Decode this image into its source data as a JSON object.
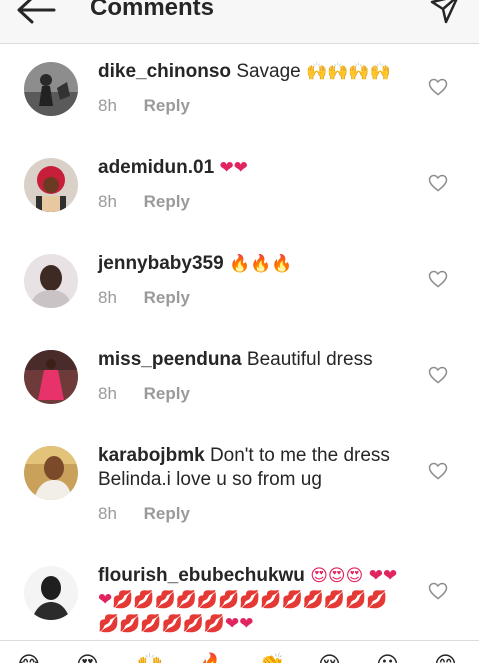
{
  "header": {
    "title": "Comments",
    "back_icon": "arrow-left-icon",
    "send_icon": "paper-plane-icon"
  },
  "comments": [
    {
      "username": "dike_chinonso",
      "text": "Savage",
      "emoji": "🙌🙌🙌🙌",
      "time": "8h",
      "reply": "Reply"
    },
    {
      "username": "ademidun.01",
      "text": "",
      "emoji": "❤❤",
      "time": "8h",
      "reply": "Reply"
    },
    {
      "username": "jennybaby359",
      "text": "",
      "emoji": "🔥🔥🔥",
      "time": "8h",
      "reply": "Reply"
    },
    {
      "username": "miss_peenduna",
      "text": "Beautiful dress",
      "emoji": "",
      "time": "8h",
      "reply": "Reply"
    },
    {
      "username": "karabojbmk",
      "text": "Don't to me the dress Belinda.i love u so from ug",
      "emoji": "",
      "time": "8h",
      "reply": "Reply"
    },
    {
      "username": "flourish_ebubechukwu",
      "text": "",
      "emoji": "😍😍😍 ❤❤❤💋💋💋💋💋💋💋💋💋💋💋💋💋💋💋💋💋💋💋❤❤",
      "time": "",
      "reply": ""
    }
  ],
  "emoji_bar": [
    "😂",
    "😍",
    "🙌",
    "🔥",
    "👏",
    "😢",
    "😮",
    "😊"
  ],
  "colors": {
    "heart_emoji": "#e0245e",
    "meta_text": "#9a9a9a",
    "divider": "#dbdbdb"
  }
}
